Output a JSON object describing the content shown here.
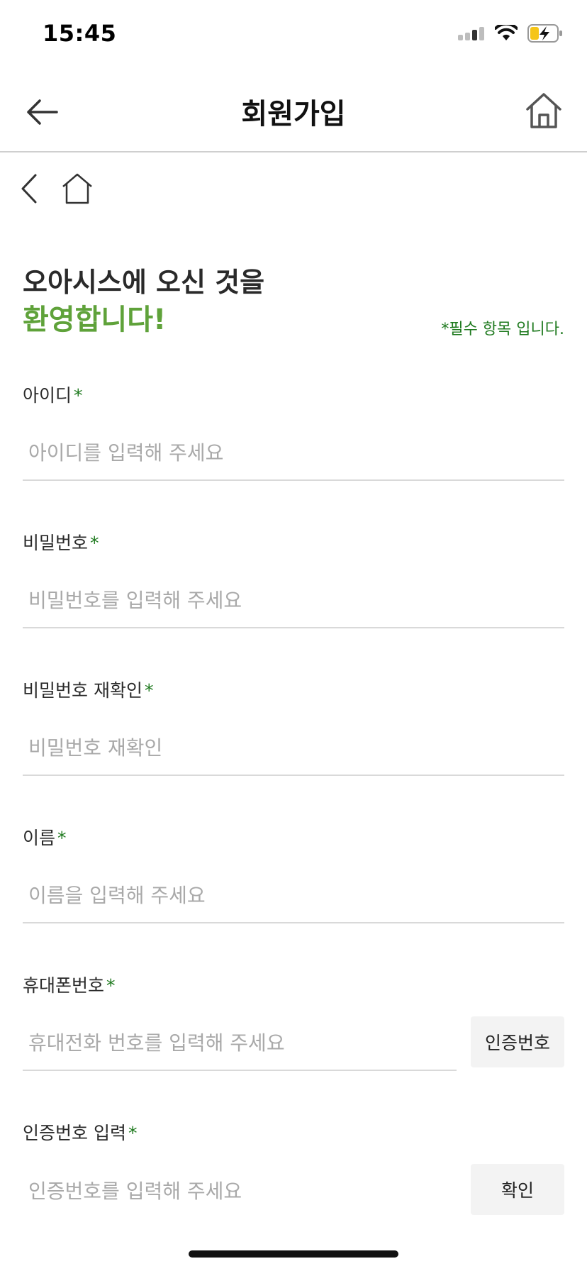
{
  "status_bar": {
    "time": "15:45"
  },
  "header": {
    "title": "회원가입"
  },
  "welcome": {
    "line1": "오아시스에 오신 것을",
    "line2": "환영합니다!",
    "required_note": "*필수 항목 입니다."
  },
  "fields": [
    {
      "label": "아이디",
      "star": "*",
      "placeholder": "아이디를 입력해 주세요"
    },
    {
      "label": "비밀번호",
      "star": "*",
      "placeholder": "비밀번호를 입력해 주세요"
    },
    {
      "label": "비밀번호 재확인",
      "star": "*",
      "placeholder": "비밀번호 재확인"
    },
    {
      "label": "이름",
      "star": "*",
      "placeholder": "이름을 입력해 주세요"
    },
    {
      "label": "휴대폰번호",
      "star": "*",
      "placeholder": "휴대전화 번호를 입력해 주세요",
      "button": "인증번호"
    },
    {
      "label": "인증번호 입력",
      "star": "*",
      "placeholder": "인증번호를 입력해 주세요",
      "button": "확인"
    }
  ],
  "colors": {
    "accent_green": "#5fa23a",
    "required_green": "#1f7a1f",
    "battery_yellow": "#f5c518"
  }
}
